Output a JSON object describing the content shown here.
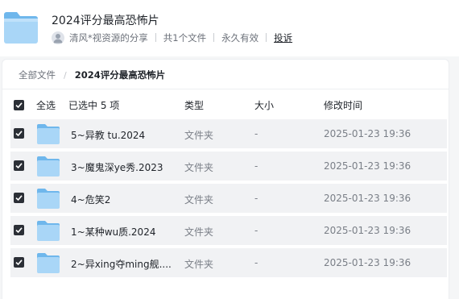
{
  "share": {
    "title": "2024评分最高恐怖片",
    "owner": "清风*视资源的分享",
    "file_count": "共1个文件",
    "validity": "永久有效",
    "report": "投诉"
  },
  "breadcrumb": {
    "root": "全部文件",
    "separator": "/",
    "current": "2024评分最高恐怖片"
  },
  "table": {
    "select_all": "全选",
    "selected_info": "已选中  5  项",
    "col_type": "类型",
    "col_size": "大小",
    "col_time": "修改时间",
    "rows": [
      {
        "name": "5~异教 tu.2024",
        "type": "文件夹",
        "size": "-",
        "time": "2025-01-23 19:36",
        "checked": true
      },
      {
        "name": "3~魔鬼深ye秀.2023",
        "type": "文件夹",
        "size": "-",
        "time": "2025-01-23 19:36",
        "checked": true
      },
      {
        "name": "4~危笑2",
        "type": "文件夹",
        "size": "-",
        "time": "2025-01-23 19:36",
        "checked": true
      },
      {
        "name": "1~某种wu质.2024",
        "type": "文件夹",
        "size": "-",
        "time": "2025-01-23 19:36",
        "checked": true
      },
      {
        "name": "2~异xing夺ming舰....",
        "type": "文件夹",
        "size": "-",
        "time": "2025-01-23 19:36",
        "checked": true
      }
    ]
  },
  "icons": {
    "folder": "folder-icon",
    "checkbox": "check-icon",
    "avatar": "user-avatar-icon"
  },
  "colors": {
    "folder_light": "#a9d6f7",
    "folder_dark": "#6fb7ec",
    "checkbox": "#2b2f36",
    "row_bg": "#f1f2f4"
  }
}
